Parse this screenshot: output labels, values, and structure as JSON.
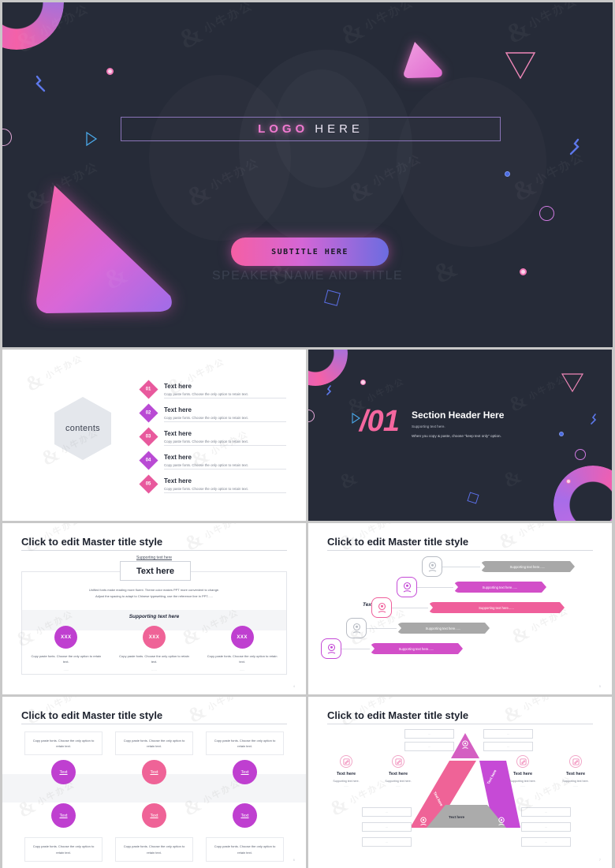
{
  "theme": {
    "dark_bg": "#262b38",
    "pink": "#f4679f",
    "magenta": "#d24fc8",
    "purple": "#b44ad6",
    "blue": "#6c6ce0",
    "gray": "#aaaaaa"
  },
  "watermark_text": "小牛办公",
  "slides": [
    {
      "id": "title-slide",
      "logo_bold": "LOGO",
      "logo_light": "HERE",
      "subtitle": "SUBTITLE HERE",
      "speaker": "SPEAKER NAME AND TITLE"
    },
    {
      "id": "contents-slide",
      "hex_label": "contents",
      "items": [
        {
          "num": "01",
          "title": "Text here",
          "desc": "Copy paste fonts. Choose the only option to retain text.",
          "color": "#e8599d"
        },
        {
          "num": "02",
          "title": "Text here",
          "desc": "Copy paste fonts. Choose the only option to retain text.",
          "color": "#b94ad4"
        },
        {
          "num": "03",
          "title": "Text here",
          "desc": "Copy paste fonts. Choose the only option to retain text.",
          "color": "#e8599d"
        },
        {
          "num": "04",
          "title": "Text here",
          "desc": "Copy paste fonts. Choose the only option to retain text.",
          "color": "#b94ad4"
        },
        {
          "num": "05",
          "title": "Text here",
          "desc": "Copy paste fonts. Choose the only option to retain text.",
          "color": "#e8599d"
        }
      ]
    },
    {
      "id": "section-slide",
      "number": "/01",
      "header": "Section Header Here",
      "sub1": "Supporting text here.",
      "sub2": "When you copy & paste, choose \"keep text only\" option."
    },
    {
      "id": "content-slide-4",
      "title": "Click to edit Master title style",
      "supporting_top": "Supporting text here",
      "box_text": "Text here",
      "paragraph_line1": "Unified fonts make reading more fluent. Theme color makes PPT more convenient to change.",
      "paragraph_line2": "Adjust the spacing to adapt to Chinese typesetting, use the reference line in PPT......",
      "band_title": "Supporting text here",
      "columns": [
        {
          "label": "XXX",
          "color": "#bf3fd0",
          "caption": "Copy paste fonts. Choose the only option to retain text.",
          "dash": "......"
        },
        {
          "label": "XXX",
          "color": "#ef6397",
          "caption": "Copy paste fonts. Choose the only option to retain text.",
          "dash": "......"
        },
        {
          "label": "XXX",
          "color": "#bf3fd0",
          "caption": "Copy paste fonts. Choose the only option to retain text.",
          "dash": "......"
        }
      ],
      "page": "4"
    },
    {
      "id": "content-slide-5",
      "title": "Click to edit Master title style",
      "left_label": "Text here",
      "rows": [
        {
          "bar_text": "Supporting text here......",
          "color": "#a8a8a8",
          "pin_color": "#b8bcc4"
        },
        {
          "bar_text": "Supporting text here......",
          "color": "#d24fc8",
          "pin_color": "#c44ad6"
        },
        {
          "bar_text": "Supporting text here......",
          "color": "#ef5f9b",
          "pin_color": "#ef5f9b"
        },
        {
          "bar_text": "Supporting text here......",
          "color": "#a8a8a8",
          "pin_color": "#b8bcc4"
        },
        {
          "bar_text": "Supporting text here......",
          "color": "#d24fc8",
          "pin_color": "#c44ad6"
        }
      ],
      "page": "5"
    },
    {
      "id": "content-slide-6",
      "title": "Click to edit Master title style",
      "top_cards": [
        {
          "text": "Copy paste fonts. Choose the only option to retain text.",
          "label": "Text",
          "color": "#bf3fd0"
        },
        {
          "text": "Copy paste fonts. Choose the only option to retain text.",
          "label": "Text",
          "color": "#ef6397"
        },
        {
          "text": "Copy paste fonts. Choose the only option to retain text.",
          "label": "Text",
          "color": "#bf3fd0"
        }
      ],
      "bottom_cards": [
        {
          "text": "Copy paste fonts. Choose the only option to retain text.",
          "label": "Text",
          "color": "#bf3fd0"
        },
        {
          "text": "Copy paste fonts. Choose the only option to retain text.",
          "label": "Text",
          "color": "#ef6397"
        },
        {
          "text": "Copy paste fonts. Choose the only option to retain text.",
          "label": "Text",
          "color": "#bf3fd0"
        }
      ],
      "page": "6"
    },
    {
      "id": "content-slide-7",
      "title": "Click to edit Master title style",
      "triangle_labels": {
        "left": "Text here",
        "right": "Text here",
        "bottom": "Text here"
      },
      "items": [
        {
          "title": "Text here",
          "sub": "Supporting text here.",
          "dash": "......"
        },
        {
          "title": "Text here",
          "sub": "Supporting text here.",
          "dash": "......"
        },
        {
          "title": "Text here",
          "sub": "Supporting text here.",
          "dash": "......"
        },
        {
          "title": "Text here",
          "sub": "Supporting text here.",
          "dash": "......"
        }
      ],
      "mini_boxes": [
        "...",
        "...",
        "...",
        "...",
        "...",
        "...",
        "...",
        "...",
        "...",
        "..."
      ],
      "page": "7"
    }
  ]
}
